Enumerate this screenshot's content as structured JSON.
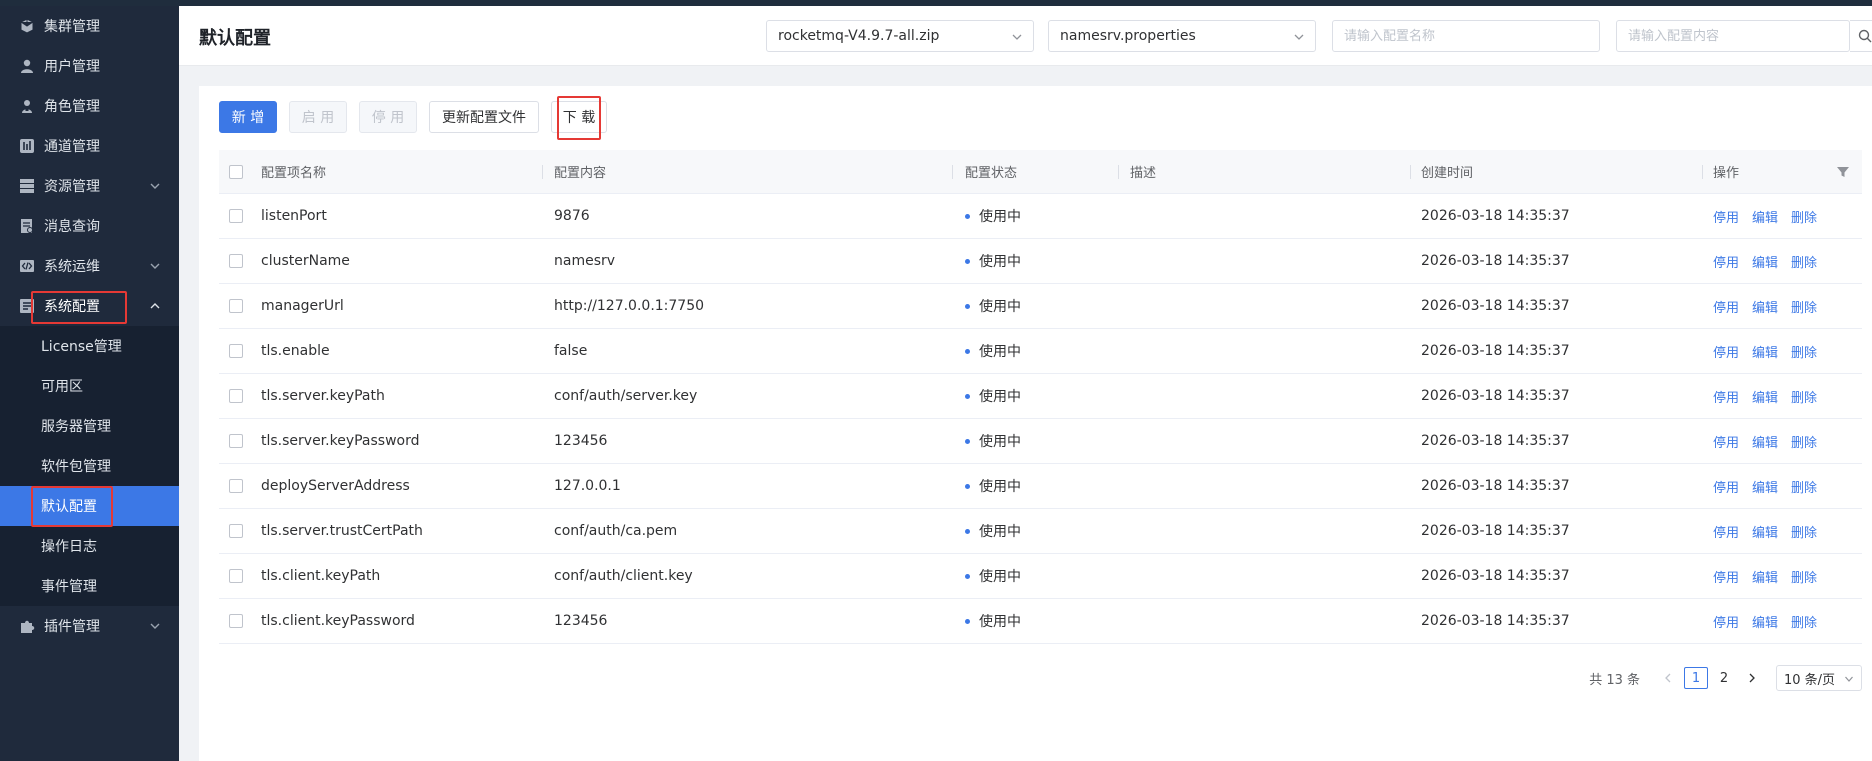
{
  "sidebar": {
    "items": [
      {
        "label": "集群管理",
        "icon": "cube-icon"
      },
      {
        "label": "用户管理",
        "icon": "user-icon"
      },
      {
        "label": "角色管理",
        "icon": "role-icon"
      },
      {
        "label": "通道管理",
        "icon": "channel-icon"
      },
      {
        "label": "资源管理",
        "icon": "server-icon"
      },
      {
        "label": "消息查询",
        "icon": "message-icon"
      },
      {
        "label": "系统运维",
        "icon": "code-icon"
      },
      {
        "label": "系统配置",
        "icon": "config-icon"
      },
      {
        "label": "插件管理",
        "icon": "puzzle-icon"
      }
    ],
    "submenu": [
      {
        "label": "License管理"
      },
      {
        "label": "可用区"
      },
      {
        "label": "服务器管理"
      },
      {
        "label": "软件包管理"
      },
      {
        "label": "默认配置"
      },
      {
        "label": "操作日志"
      },
      {
        "label": "事件管理"
      }
    ]
  },
  "header": {
    "title": "默认配置",
    "package_select": "rocketmq-V4.9.7-all.zip",
    "file_select": "namesrv.properties",
    "name_placeholder": "请输入配置名称",
    "content_placeholder": "请输入配置内容"
  },
  "toolbar": {
    "add_label": "新 增",
    "enable_label": "启 用",
    "disable_label": "停 用",
    "update_label": "更新配置文件",
    "download_label": "下 载"
  },
  "table": {
    "columns": [
      "配置项名称",
      "配置内容",
      "配置状态",
      "描述",
      "创建时间",
      "操作"
    ],
    "rows": [
      {
        "name": "listenPort",
        "content": "9876",
        "status": "使用中",
        "desc": "",
        "time": "2026-03-18 14:35:37"
      },
      {
        "name": "clusterName",
        "content": "namesrv",
        "status": "使用中",
        "desc": "",
        "time": "2026-03-18 14:35:37"
      },
      {
        "name": "managerUrl",
        "content": "http://127.0.0.1:7750",
        "status": "使用中",
        "desc": "",
        "time": "2026-03-18 14:35:37"
      },
      {
        "name": "tls.enable",
        "content": "false",
        "status": "使用中",
        "desc": "",
        "time": "2026-03-18 14:35:37"
      },
      {
        "name": "tls.server.keyPath",
        "content": "conf/auth/server.key",
        "status": "使用中",
        "desc": "",
        "time": "2026-03-18 14:35:37"
      },
      {
        "name": "tls.server.keyPassword",
        "content": "123456",
        "status": "使用中",
        "desc": "",
        "time": "2026-03-18 14:35:37"
      },
      {
        "name": "deployServerAddress",
        "content": "127.0.0.1",
        "status": "使用中",
        "desc": "",
        "time": "2026-03-18 14:35:37"
      },
      {
        "name": "tls.server.trustCertPath",
        "content": "conf/auth/ca.pem",
        "status": "使用中",
        "desc": "",
        "time": "2026-03-18 14:35:37"
      },
      {
        "name": "tls.client.keyPath",
        "content": "conf/auth/client.key",
        "status": "使用中",
        "desc": "",
        "time": "2026-03-18 14:35:37"
      },
      {
        "name": "tls.client.keyPassword",
        "content": "123456",
        "status": "使用中",
        "desc": "",
        "time": "2026-03-18 14:35:37"
      }
    ],
    "actions": {
      "disable": "停用",
      "edit": "编辑",
      "delete": "删除"
    }
  },
  "pagination": {
    "total": "共 13 条",
    "pages": [
      "1",
      "2"
    ],
    "current": "1",
    "page_size": "10 条/页"
  },
  "colors": {
    "primary": "#3c78e6",
    "sidebar_bg": "#1f2a3c",
    "highlight": "#e53935"
  }
}
